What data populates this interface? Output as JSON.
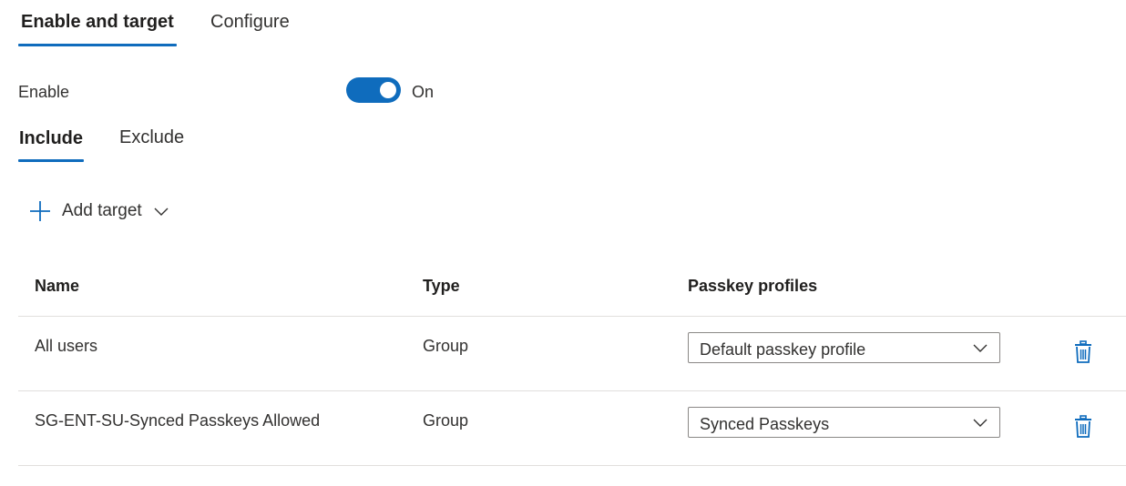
{
  "tabs": {
    "top": [
      {
        "label": "Enable and target",
        "active": true
      },
      {
        "label": "Configure",
        "active": false
      }
    ],
    "sub": [
      {
        "label": "Include",
        "active": true
      },
      {
        "label": "Exclude",
        "active": false
      }
    ]
  },
  "enable": {
    "label": "Enable",
    "toggle_state": "On",
    "is_on": true
  },
  "actions": {
    "add_target_label": "Add target"
  },
  "table": {
    "columns": [
      "Name",
      "Type",
      "Passkey profiles"
    ],
    "rows": [
      {
        "name": "All users",
        "type": "Group",
        "passkey_profile": "Default passkey profile"
      },
      {
        "name": "SG-ENT-SU-Synced Passkeys Allowed",
        "type": "Group",
        "passkey_profile": "Synced Passkeys"
      }
    ]
  },
  "icons": {
    "add": "plus-icon",
    "dropdown": "chevron-down-icon",
    "delete": "trash-icon"
  },
  "colors": {
    "accent": "#0f6cbd",
    "text": "#323130",
    "divider": "#e1dfdd",
    "input_border": "#8a8886"
  }
}
